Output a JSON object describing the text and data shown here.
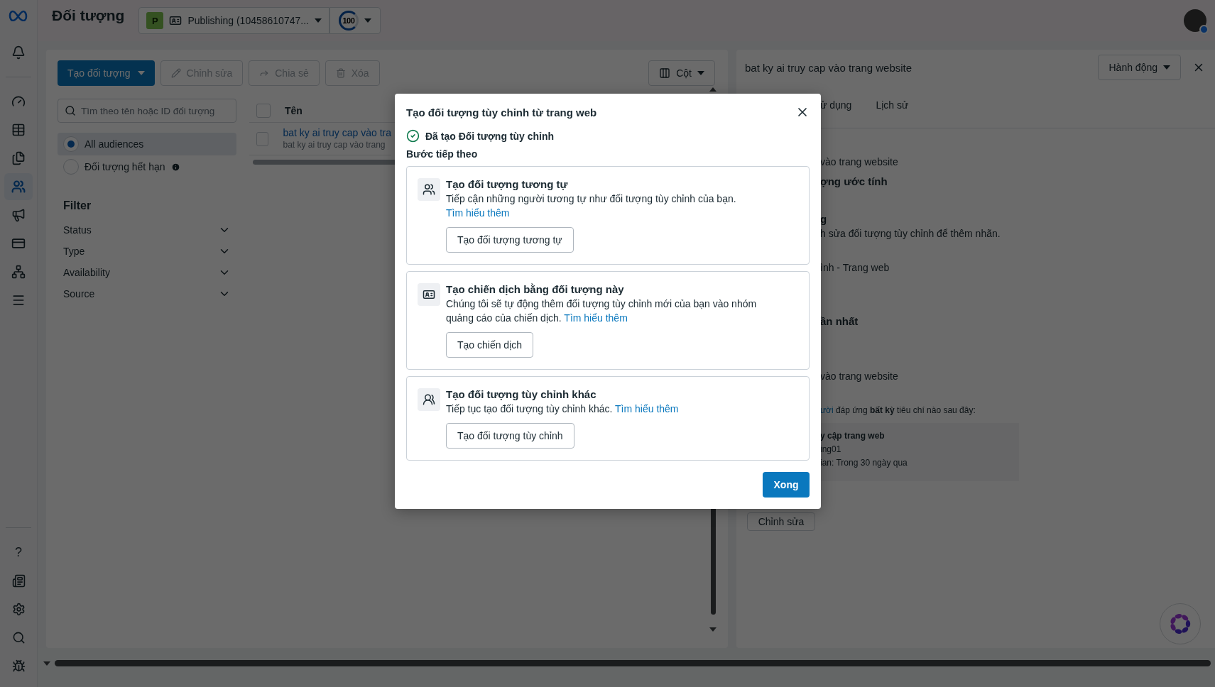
{
  "header": {
    "title": "Đối tượng",
    "account": {
      "initial": "P",
      "name": "Publishing (10458610747..."
    },
    "score": "100"
  },
  "sidebar": {
    "items": [
      {
        "selected": false
      },
      {
        "selected": false
      },
      {
        "selected": false
      },
      {
        "selected": false
      },
      {
        "selected": true
      },
      {
        "selected": false
      },
      {
        "selected": false
      },
      {
        "selected": false
      },
      {
        "selected": false
      }
    ],
    "help": "?"
  },
  "toolbar": {
    "create": "Tạo đối tượng",
    "actions": [
      {
        "label": "Chỉnh sửa",
        "disabled": true
      },
      {
        "label": "Chia sẻ",
        "disabled": true
      },
      {
        "label": "Xóa",
        "disabled": true
      }
    ],
    "columns": "Cột"
  },
  "search": {
    "placeholder": "Tìm theo tên hoặc ID đối tượng"
  },
  "audience_filters": [
    {
      "label": "All audiences",
      "selected": true,
      "info": false
    },
    {
      "label": "Đối tượng hết hạn",
      "selected": false,
      "info": true
    }
  ],
  "filter": {
    "title": "Filter",
    "items": [
      {
        "label": "Status",
        "expanded": false
      },
      {
        "label": "Type",
        "expanded": false
      },
      {
        "label": "Availability",
        "expanded": false
      },
      {
        "label": "Source",
        "expanded": false
      }
    ]
  },
  "table": {
    "select_all": {
      "checked": false
    },
    "columns": [
      "Tên"
    ],
    "rows": [
      {
        "name": "bat ky ai truy cap vào tra",
        "subtitle": "bat ky ai truy cap vào trang",
        "checked": false
      }
    ]
  },
  "detail_panel": {
    "title": "bat ky ai truy cap vào trang website",
    "action": "Hành động",
    "tabs": [
      "ử dụng",
      "Lịch sử"
    ],
    "fragments": [
      {
        "kind": "value",
        "text": "vào trang website"
      },
      {
        "kind": "label",
        "text": "ợng ước tính"
      },
      {
        "kind": "label",
        "text": "g"
      },
      {
        "kind": "value",
        "text": "h sửa đối tượng tùy chỉnh để thêm nhãn."
      },
      {
        "kind": "value",
        "text": "ình - Trang web"
      },
      {
        "kind": "label",
        "text": "ần nhất"
      },
      {
        "kind": "value",
        "text": "vào trang website"
      },
      {
        "kind": "criteria",
        "link": "ười",
        "text": "đáp ứng **bất kỳ** tiêu chí nào sau đây:"
      },
      {
        "kind": "summary",
        "lines": [
          "y cập trang web",
          "ing01",
          "ian: Trong 30 ngày qua"
        ]
      },
      {
        "kind": "button",
        "text": "Chỉnh sửa"
      }
    ]
  },
  "dialog": {
    "title": "Tạo đối tượng tùy chỉnh từ trang web",
    "status": "Đã tạo Đối tượng tùy chỉnh",
    "subtitle": "Bước tiếp theo",
    "options": [
      {
        "title": "Tạo đối tượng tương tự",
        "description": "Tiếp cận những người tương tự như đối tượng tùy chỉnh của bạn.",
        "link": "Tìm hiểu thêm",
        "button": "Tạo đối tượng tương tự"
      },
      {
        "title": "Tạo chiến dịch bằng đối tượng này",
        "description": "Chúng tôi sẽ tự động thêm đối tượng tùy chỉnh mới của bạn vào nhóm quảng cáo của chiến dịch.",
        "link": "Tìm hiểu thêm",
        "button": "Tạo chiến dịch"
      },
      {
        "title": "Tạo đối tượng tùy chỉnh khác",
        "description": "Tiếp tục tạo đối tượng tùy chỉnh khác.",
        "link": "Tìm hiểu thêm",
        "button": "Tạo đối tượng tùy chỉnh"
      }
    ],
    "done": "Xong"
  }
}
